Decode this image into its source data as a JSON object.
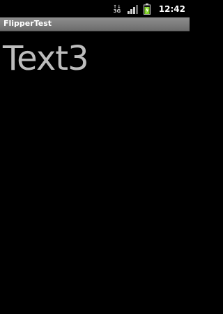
{
  "status_bar": {
    "network_type_top": "↑↓",
    "network_type": "3G",
    "time": "12:42",
    "icons": [
      "network-type-icon",
      "signal-strength-icon",
      "battery-charging-icon"
    ]
  },
  "app": {
    "title": "FlipperTest"
  },
  "flipper": {
    "current_text": "Text3"
  },
  "colors": {
    "background": "#000000",
    "title_bar": "#7d7d7d",
    "text": "#bdbdbd",
    "battery": "#7ed321"
  }
}
